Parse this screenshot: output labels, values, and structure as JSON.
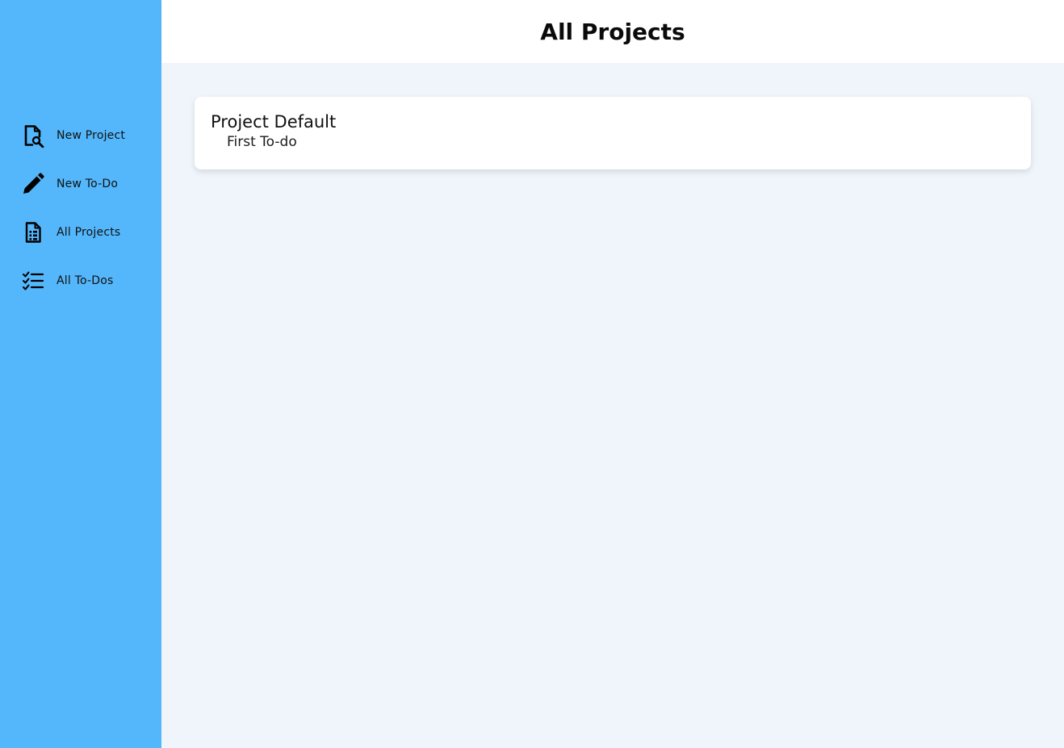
{
  "header": {
    "title": "All Projects"
  },
  "sidebar": {
    "items": [
      {
        "label": "New Project",
        "icon": "new-project-icon"
      },
      {
        "label": "New To-Do",
        "icon": "pencil-icon"
      },
      {
        "label": "All Projects",
        "icon": "document-list-icon"
      },
      {
        "label": "All To-Dos",
        "icon": "checklist-icon"
      }
    ]
  },
  "main": {
    "projects": [
      {
        "title": "Project Default",
        "todos": [
          "First To-do"
        ]
      }
    ]
  },
  "colors": {
    "sidebar": "#54b7fb",
    "main_background": "#f0f5fc",
    "header": "#ffffff",
    "card": "#ffffff"
  }
}
